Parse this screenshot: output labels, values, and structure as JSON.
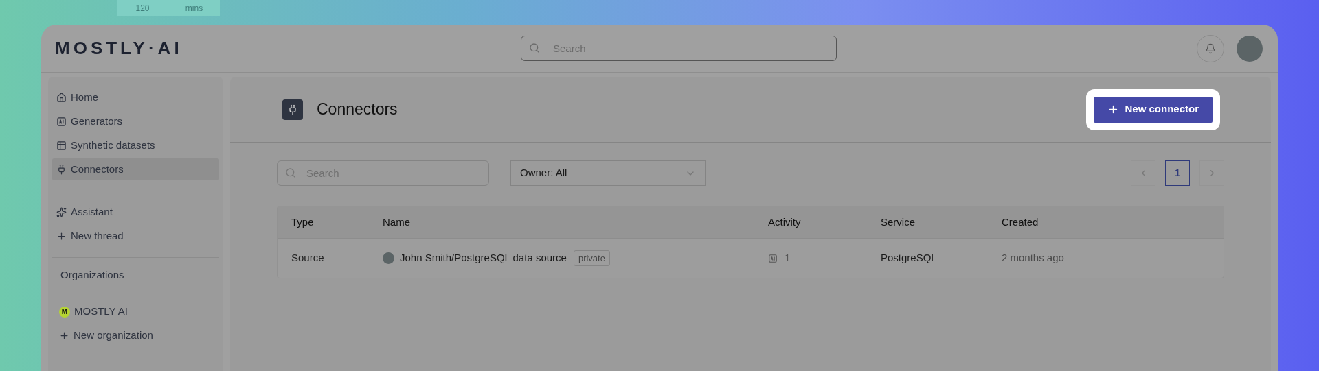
{
  "backdrop": {
    "texts": [
      "120",
      "mins"
    ]
  },
  "header": {
    "logo": "MOSTLY·AI",
    "search": {
      "placeholder": "Search"
    }
  },
  "sidebar": {
    "groups": [
      {
        "items": [
          {
            "label": "Home",
            "kind": "home",
            "selected": false
          },
          {
            "label": "Generators",
            "kind": "ai",
            "selected": false
          },
          {
            "label": "Synthetic datasets",
            "kind": "table",
            "selected": false
          },
          {
            "label": "Connectors",
            "kind": "plug",
            "selected": true
          }
        ]
      },
      {
        "items": [
          {
            "label": "Assistant",
            "kind": "sparkle",
            "selected": false
          },
          {
            "label": "New thread",
            "kind": "plus",
            "selected": false
          }
        ]
      }
    ],
    "organizations": {
      "title": "Organizations",
      "items": [
        {
          "label": "MOSTLY AI",
          "kind": "org",
          "badge": "M",
          "color": "#b5d334"
        },
        {
          "label": "New organization",
          "kind": "plus"
        }
      ]
    }
  },
  "page": {
    "title": "Connectors",
    "new_button": "New connector"
  },
  "filters": {
    "search": {
      "placeholder": "Search"
    },
    "owner": "Owner: All"
  },
  "pagination": {
    "pages": [
      {
        "label": "1",
        "selected": true
      }
    ]
  },
  "table": {
    "columns": [
      "Type",
      "Name",
      "Activity",
      "Service",
      "Created"
    ],
    "rows": [
      {
        "type": "Source",
        "name": "John Smith/PostgreSQL data source",
        "tag": "private",
        "activity": "1",
        "service": "PostgreSQL",
        "created": "2 months ago"
      }
    ]
  }
}
